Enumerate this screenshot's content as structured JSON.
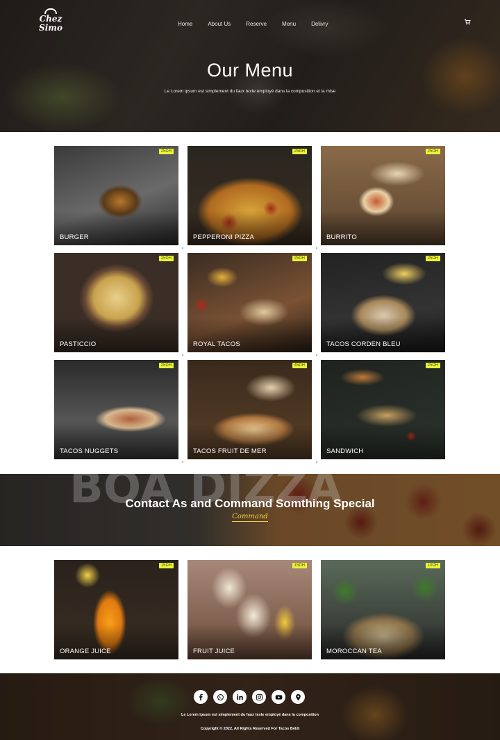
{
  "header": {
    "logo_text": "Chez Simo",
    "nav": [
      "Home",
      "About Us",
      "Reserve",
      "Menu",
      "Delivry"
    ],
    "title": "Our Menu",
    "subtitle": "Le Lorem ipsum est simplement du faux texte employé dans la composition et la mise"
  },
  "menu_items": [
    {
      "name": "BURGER",
      "price": "25DH"
    },
    {
      "name": "PEPPERONI PIZZA",
      "price": "25DH"
    },
    {
      "name": "BURRITO",
      "price": "25DH"
    },
    {
      "name": "PASTICCIO",
      "price": "25DH"
    },
    {
      "name": "ROYAL TACOS",
      "price": "25DH"
    },
    {
      "name": "TACOS CORDEN BLEU",
      "price": "25DH"
    },
    {
      "name": "TACOS NUGGETS",
      "price": "25DH"
    },
    {
      "name": "TACOS FRUIT DE MER",
      "price": "45DH"
    },
    {
      "name": "SANDWICH",
      "price": "25DH"
    }
  ],
  "contact": {
    "title": "Contact As and Command Somthing Special",
    "link": "Command",
    "bg_text": "BOA DIZZA"
  },
  "drinks": [
    {
      "name": "ORANGE JUICE",
      "price": "15DH"
    },
    {
      "name": "FRUIT JUICE",
      "price": "15DH"
    },
    {
      "name": "MOROCCAN TEA",
      "price": "10DH"
    }
  ],
  "footer": {
    "socials": [
      "facebook-icon",
      "whatsapp-icon",
      "linkedin-icon",
      "instagram-icon",
      "youtube-icon",
      "location-icon"
    ],
    "text": "Le Lorem ipsum est simplement du faux texte employé dans la composition",
    "copyright": "Copyright © 2022, All Rights Reserved For Tacos Beldi"
  },
  "colors": {
    "price_badge": "#e9f33a",
    "command_link": "#f0d23a"
  }
}
